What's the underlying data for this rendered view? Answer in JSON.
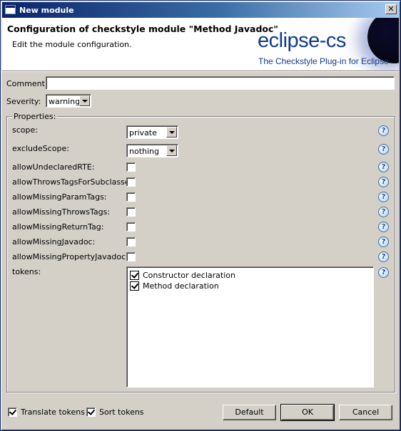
{
  "window": {
    "title": "New module",
    "close_glyph": "✕"
  },
  "header": {
    "title": "Configuration of checkstyle module \"Method Javadoc\"",
    "description": "Edit the module configuration.",
    "logo_text": "eclipse-cs",
    "logo_subtitle": "The Checkstyle Plug-in for Eclipse"
  },
  "form": {
    "comment_label": "Comment:",
    "comment_value": "",
    "severity_label": "Severity:",
    "severity_value": "warning"
  },
  "properties": {
    "group_label": "Properties:",
    "help_glyph": "?",
    "scope": {
      "label": "scope:",
      "value": "private"
    },
    "excludeScope": {
      "label": "excludeScope:",
      "value": "nothing"
    },
    "checkboxes": [
      {
        "label": "allowUndeclaredRTE:",
        "checked": false
      },
      {
        "label": "allowThrowsTagsForSubclasses:",
        "checked": false
      },
      {
        "label": "allowMissingParamTags:",
        "checked": false
      },
      {
        "label": "allowMissingThrowsTags:",
        "checked": false
      },
      {
        "label": "allowMissingReturnTag:",
        "checked": false
      },
      {
        "label": "allowMissingJavadoc:",
        "checked": false
      },
      {
        "label": "allowMissingPropertyJavadoc:",
        "checked": false
      }
    ],
    "tokens": {
      "label": "tokens:",
      "items": [
        {
          "label": "Constructor declaration",
          "checked": true
        },
        {
          "label": "Method declaration",
          "checked": true
        }
      ]
    }
  },
  "footer": {
    "translate_tokens": {
      "label": "Translate tokens",
      "checked": true
    },
    "sort_tokens": {
      "label": "Sort tokens",
      "checked": true
    },
    "default_button": "Default",
    "ok_button": "OK",
    "cancel_button": "Cancel"
  }
}
